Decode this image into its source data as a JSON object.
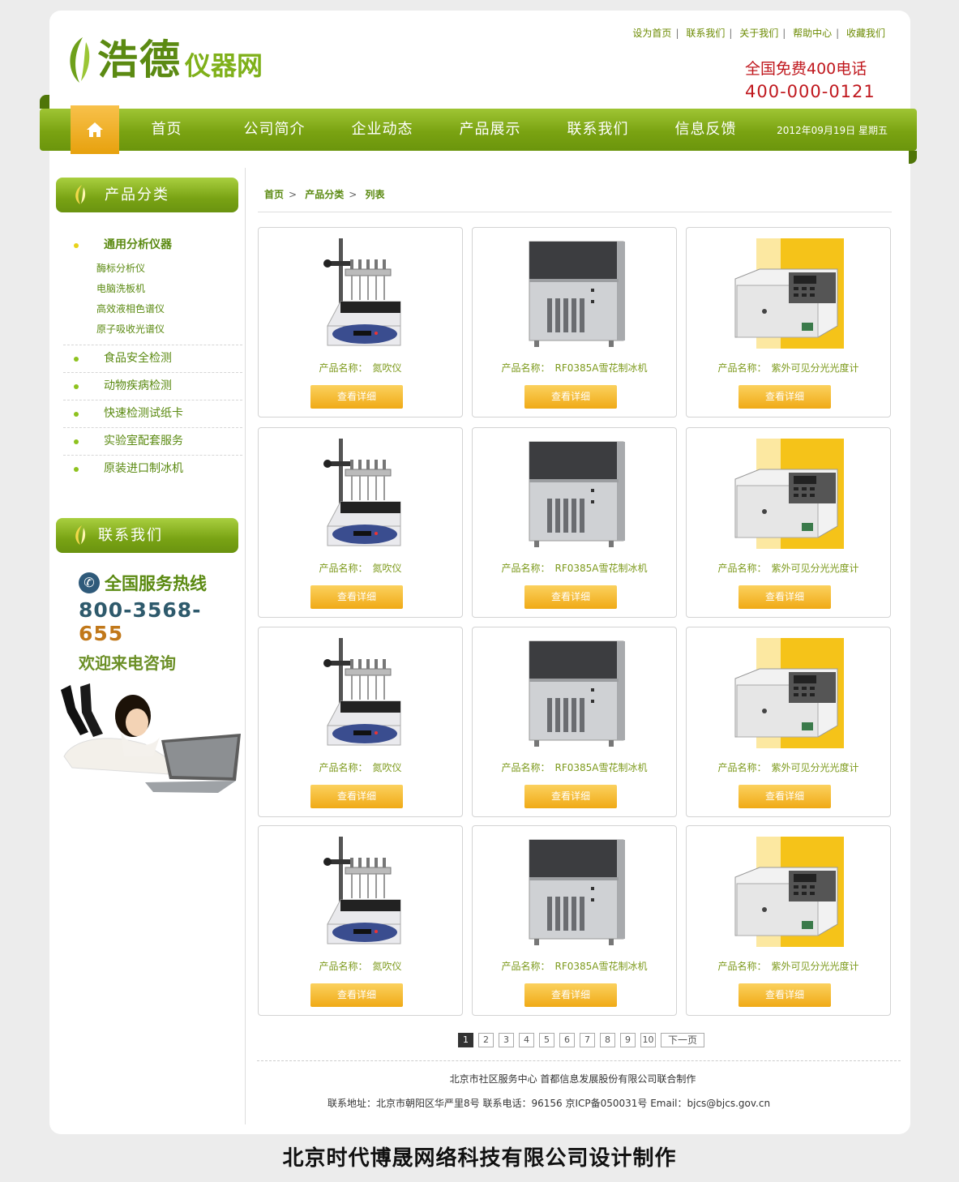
{
  "header": {
    "top_links": [
      "设为首页",
      "联系我们",
      "关于我们",
      "帮助中心",
      "收藏我们"
    ],
    "logo_big": "浩德",
    "logo_small": "仪器网",
    "hotline_label": "全国免费400电话",
    "hotline_number": "400-000-0121"
  },
  "nav": {
    "items": [
      "首页",
      "公司简介",
      "企业动态",
      "产品展示",
      "联系我们",
      "信息反馈"
    ],
    "date": "2012年09月19日 星期五"
  },
  "sidebar": {
    "category_title": "产品分类",
    "categories": [
      {
        "label": "通用分析仪器",
        "subs": [
          "酶标分析仪",
          "电脑洗板机",
          "高效液相色谱仪",
          "原子吸收光谱仪"
        ]
      },
      {
        "label": "食品安全检测"
      },
      {
        "label": "动物疾病检测"
      },
      {
        "label": "快速检测试纸卡"
      },
      {
        "label": "实验室配套服务"
      },
      {
        "label": "原装进口制冰机"
      }
    ],
    "contact_title": "联系我们",
    "service_line": "全国服务热线",
    "service_number_a": "800-3568-",
    "service_number_b": "655",
    "welcome": "欢迎来电咨询"
  },
  "breadcrumb": [
    "首页",
    "产品分类",
    "列表"
  ],
  "products": {
    "name_label": "产品名称：",
    "button_label": "查看详细",
    "items": [
      {
        "name": "氮吹仪",
        "icon": "nitrogen-evaporator"
      },
      {
        "name": "RF0385A雪花制冰机",
        "icon": "ice-machine"
      },
      {
        "name": "紫外可见分光光度计",
        "icon": "spectrophotometer"
      },
      {
        "name": "氮吹仪",
        "icon": "nitrogen-evaporator"
      },
      {
        "name": "RF0385A雪花制冰机",
        "icon": "ice-machine"
      },
      {
        "name": "紫外可见分光光度计",
        "icon": "spectrophotometer"
      },
      {
        "name": "氮吹仪",
        "icon": "nitrogen-evaporator"
      },
      {
        "name": "RF0385A雪花制冰机",
        "icon": "ice-machine"
      },
      {
        "name": "紫外可见分光光度计",
        "icon": "spectrophotometer"
      },
      {
        "name": "氮吹仪",
        "icon": "nitrogen-evaporator"
      },
      {
        "name": "RF0385A雪花制冰机",
        "icon": "ice-machine"
      },
      {
        "name": "紫外可见分光光度计",
        "icon": "spectrophotometer"
      }
    ]
  },
  "pager": {
    "pages": [
      "1",
      "2",
      "3",
      "4",
      "5",
      "6",
      "7",
      "8",
      "9",
      "10"
    ],
    "current": "1",
    "next": "下一页"
  },
  "footer": {
    "line1": "北京市社区服务中心 首都信息发展股份有限公司联合制作",
    "line2": "联系地址：北京市朝阳区华严里8号 联系电话：96156 京ICP备050031号 Email：bjcs@bjcs.gov.cn"
  },
  "credit": "北京时代博晟网络科技有限公司设计制作",
  "colors": {
    "green": "#7aa312",
    "orange": "#f0aa16",
    "red": "#c0181e"
  }
}
